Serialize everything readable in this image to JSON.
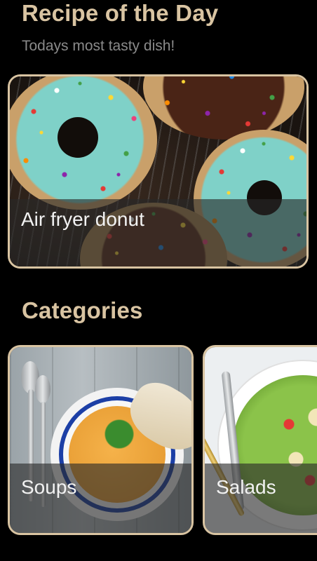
{
  "header": {
    "title": "Recipe of the Day",
    "subtitle": "Todays most tasty dish!"
  },
  "recipe_of_day": {
    "caption": "Air fryer donut"
  },
  "categories": {
    "title": "Categories",
    "items": [
      {
        "label": "Soups"
      },
      {
        "label": "Salads"
      }
    ]
  },
  "colors": {
    "background": "#000000",
    "accent": "#d9c4a2",
    "subtitle": "#8a8a8a",
    "caption_text": "#f2f2f2"
  }
}
